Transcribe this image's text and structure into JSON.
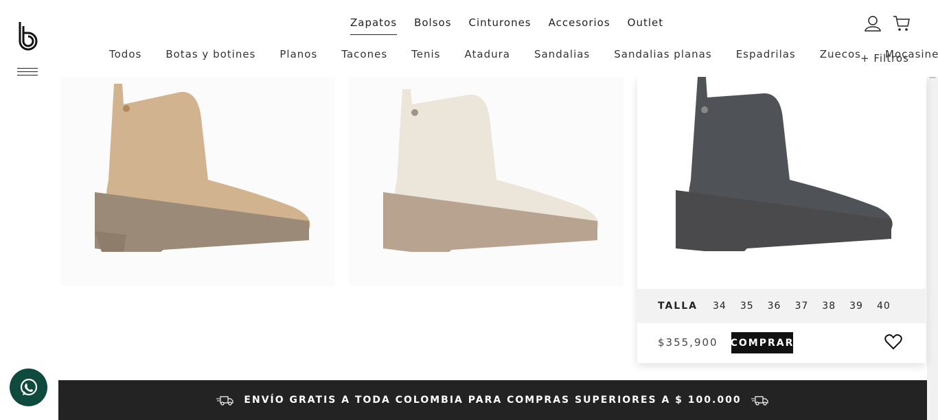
{
  "header": {
    "main_nav": [
      {
        "label": "Zapatos",
        "active": true
      },
      {
        "label": "Bolsos",
        "active": false
      },
      {
        "label": "Cinturones",
        "active": false
      },
      {
        "label": "Accesorios",
        "active": false
      },
      {
        "label": "Outlet",
        "active": false
      }
    ],
    "sub_nav": [
      "Todos",
      "Botas y botines",
      "Planos",
      "Tacones",
      "Tenis",
      "Atadura",
      "Sandalias",
      "Sandalias planas",
      "Espadrilas",
      "Zuecos",
      "Mocasines"
    ],
    "filters_label": "+ Filtros",
    "icons": [
      "user-icon",
      "cart-icon",
      "logo-icon",
      "hamburger-icon"
    ]
  },
  "products": [
    {
      "color": "#d2b38f",
      "sole": "#9b8a77"
    },
    {
      "color": "#ece5da",
      "sole": "#b7a390"
    },
    {
      "color": "#4f5256",
      "sole": "#4a4a4c"
    }
  ],
  "card": {
    "size_label": "TALLA",
    "sizes": [
      "34",
      "35",
      "36",
      "37",
      "38",
      "39",
      "40"
    ],
    "price": "$355,900",
    "buy_label": "COMPRAR"
  },
  "banner": {
    "text": "ENVÍO GRATIS A TODA COLOMBIA PARA COMPRAS SUPERIORES A $ 100.000"
  },
  "colors": {
    "banner_bg": "#232323",
    "whatsapp_bg": "#0f4a3e",
    "button_bg": "#111111"
  }
}
